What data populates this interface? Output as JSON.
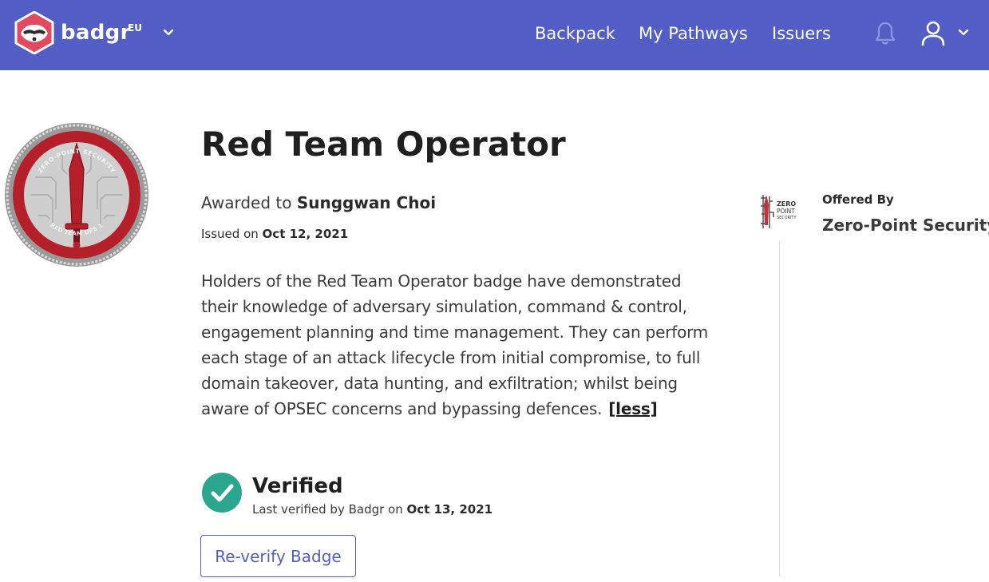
{
  "app": {
    "brand": "badgr",
    "brand_region": "EU",
    "accent_color": "#535dc6"
  },
  "nav": {
    "items": [
      {
        "label": "Backpack"
      },
      {
        "label": "My Pathways"
      },
      {
        "label": "Issuers"
      }
    ],
    "icons": [
      "badgr-logo-icon",
      "chevron-down-icon",
      "bell-icon",
      "user-icon",
      "chevron-down-icon"
    ]
  },
  "badge": {
    "title": "Red Team Operator",
    "awarded_prefix": "Awarded to",
    "recipient": "Sunggwan Choi",
    "issued_prefix": "Issued on",
    "issued_date": "Oct 12, 2021",
    "description": "Holders of the Red Team Operator badge have demonstrated their knowledge of adversary simulation, command & control, engagement planning and time management. They can perform each stage of an attack lifecycle from initial compromise, to full domain takeover, data hunting, and exfiltration; whilst being aware of OPSEC concerns and bypassing defences.",
    "less_label": "[less]",
    "image_top_text": "ZERO-POINT SECURITY",
    "image_bottom_text": "RED TEAM OPS 1"
  },
  "verification": {
    "status": "Verified",
    "last_verified_prefix": "Last verified by Badgr on",
    "last_verified_date": "Oct 13, 2021",
    "reverify_label": "Re-verify Badge",
    "status_color": "#2aa68f"
  },
  "issuer": {
    "offered_label": "Offered By",
    "name": "Zero-Point Security",
    "logo_text": [
      "ZERO",
      "POINT",
      "SECURITY"
    ]
  }
}
